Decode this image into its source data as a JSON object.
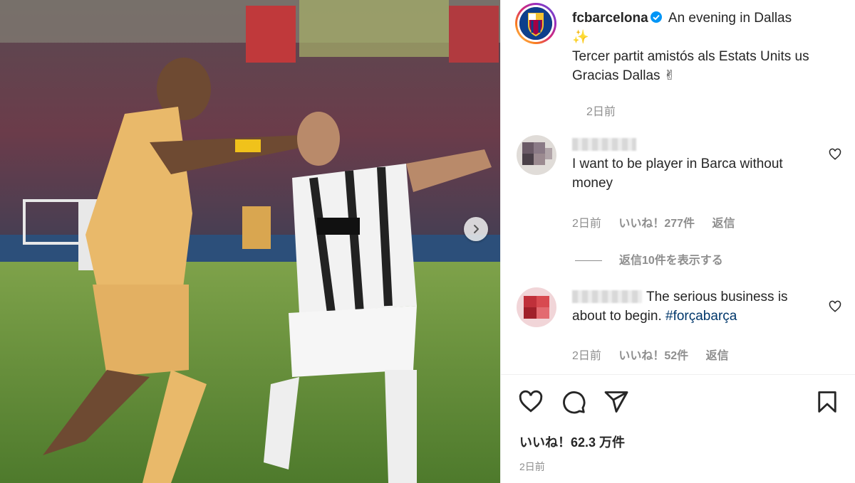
{
  "post": {
    "username": "fcbarcelona",
    "caption_line1": "An evening in Dallas",
    "caption_sparkle": "✨",
    "caption_line2": "Tercer partit amistós als Estats Units us",
    "caption_line3": "Gracias Dallas ✌",
    "caption_time": "2日前",
    "likes": "いいね！62.3 万件",
    "post_time": "2日前"
  },
  "comments": [
    {
      "text": "I want to be player in Barca without money",
      "time": "2日前",
      "likes": "いいね！277件",
      "reply_label": "返信"
    },
    {
      "text_plain": "The serious business is about to begin. ",
      "hashtag": "#forçabarça",
      "time": "2日前",
      "likes": "いいね！52件",
      "reply_label": "返信"
    }
  ],
  "view_replies": "返信10件を表示する",
  "colors": {
    "accent_link": "#00376b",
    "verified_blue": "#0095f6",
    "secondary_text": "#8e8e8e"
  },
  "icons": [
    "heart-icon",
    "comment-icon",
    "share-icon",
    "bookmark-icon",
    "chevron-right-icon",
    "verified-icon"
  ]
}
